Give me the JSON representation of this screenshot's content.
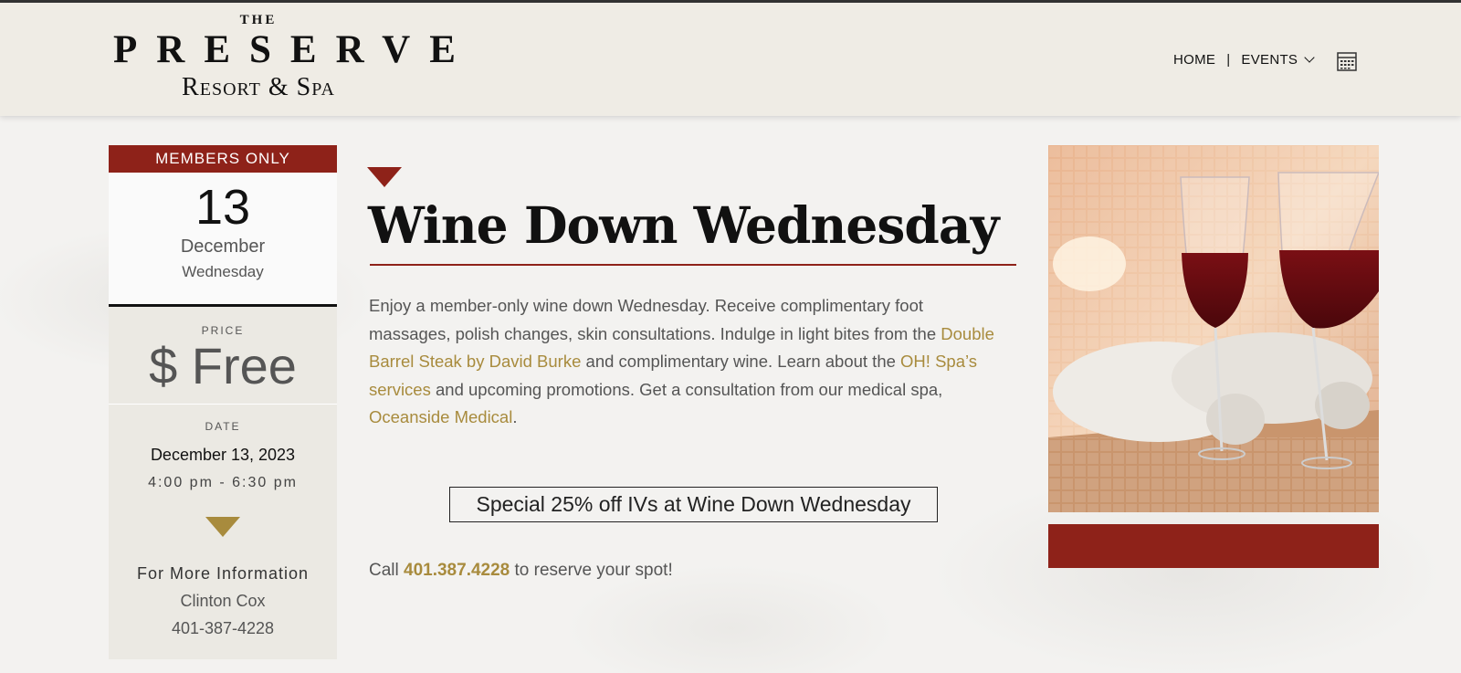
{
  "brand": {
    "the": "THE",
    "name": "PRESERVE",
    "sub": "Resort & Spa"
  },
  "nav": {
    "home": "HOME",
    "separator": "|",
    "events": "EVENTS",
    "calendar_icon": "calendar-icon"
  },
  "event_card": {
    "members_label": "MEMBERS ONLY",
    "day": "13",
    "month": "December",
    "weekday": "Wednesday",
    "price_label": "PRICE",
    "price": "$ Free",
    "date_label": "DATE",
    "date": "December 13, 2023",
    "time": "4:00 pm - 6:30 pm",
    "more_info": "For More Information",
    "contact_name": "Clinton Cox",
    "contact_phone": "401-387-4228"
  },
  "event": {
    "title": "Wine Down Wednesday",
    "desc_1": "Enjoy a member-only wine down Wednesday. Receive complimentary foot massages, polish changes, skin consultations. Indulge in light bites from the ",
    "link_1": "Double Barrel Steak by David Burke",
    "desc_2": " and complimentary wine. Learn about the ",
    "link_2": "OH! Spa’s services",
    "desc_3": " and upcoming promotions. Get a consultation from our medical spa, ",
    "link_3": "Oceanside Medical",
    "desc_4": ".",
    "promo": "Special 25% off IVs at Wine Down Wednesday",
    "call_prefix": "Call ",
    "call_phone": "401.387.4228",
    "call_suffix": " to reserve your spot!"
  },
  "colors": {
    "accent_red": "#8e2219",
    "accent_gold": "#a88b3d",
    "header_bg": "#efece5"
  }
}
